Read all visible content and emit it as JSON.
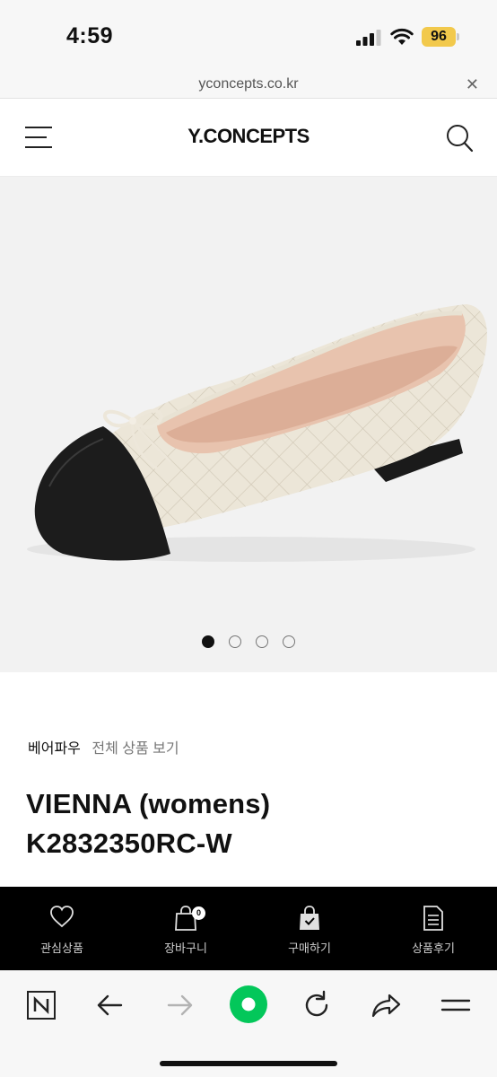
{
  "status_bar": {
    "time": "4:59",
    "battery": "96",
    "battery_color": "#f2c94c"
  },
  "url_bar": {
    "url": "yconcepts.co.kr",
    "close_icon": "close-icon"
  },
  "header": {
    "logo": "Y.CONCEPTS",
    "menu_icon": "hamburger-icon",
    "search_icon": "search-icon"
  },
  "gallery": {
    "image": "cream quilted ballet flat with black cap toe and bow",
    "page_count": 4,
    "active_index": 0
  },
  "product": {
    "brand": "베어파우",
    "all_products_link": "전체 상품 보기",
    "title_line1": "VIENNA (womens)",
    "title_line2": "K2832350RC-W"
  },
  "action_bar": {
    "wishlist": "관심상품",
    "cart": "장바구니",
    "cart_count": "0",
    "buy": "구매하기",
    "reviews": "상품후기"
  },
  "browser_toolbar": {
    "icons": [
      "naver-n-icon",
      "back-arrow-icon",
      "forward-arrow-icon",
      "green-home-icon",
      "reload-icon",
      "share-icon",
      "menu-icon"
    ],
    "accent": "#03c75a"
  }
}
